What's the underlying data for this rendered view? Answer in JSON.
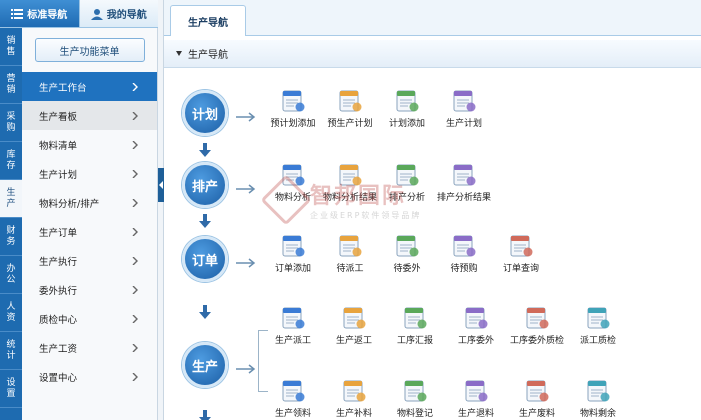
{
  "left_tabs": [
    {
      "label": "标准导航",
      "icon": "list-icon",
      "active": true
    },
    {
      "label": "我的导航",
      "icon": "user-icon",
      "active": false
    }
  ],
  "categories": [
    {
      "label": "销售",
      "active": false
    },
    {
      "label": "营销",
      "active": false
    },
    {
      "label": "采购",
      "active": false
    },
    {
      "label": "库存",
      "active": false
    },
    {
      "label": "生产",
      "active": true
    },
    {
      "label": "财务",
      "active": false
    },
    {
      "label": "办公",
      "active": false
    },
    {
      "label": "人资",
      "active": false
    },
    {
      "label": "统计",
      "active": false
    },
    {
      "label": "设置",
      "active": false
    }
  ],
  "menu": {
    "header_button": "生产功能菜单",
    "items": [
      {
        "label": "生产工作台",
        "state": "active"
      },
      {
        "label": "生产看板",
        "state": "hover"
      },
      {
        "label": "物料清单",
        "state": ""
      },
      {
        "label": "生产计划",
        "state": ""
      },
      {
        "label": "物料分析/排产",
        "state": ""
      },
      {
        "label": "生产订单",
        "state": ""
      },
      {
        "label": "生产执行",
        "state": ""
      },
      {
        "label": "委外执行",
        "state": ""
      },
      {
        "label": "质检中心",
        "state": ""
      },
      {
        "label": "生产工资",
        "state": ""
      },
      {
        "label": "设置中心",
        "state": ""
      }
    ]
  },
  "main_tab": "生产导航",
  "panel_title": "生产导航",
  "flow": {
    "stages": [
      "计划",
      "排产",
      "订单",
      "生产"
    ],
    "plan_items": [
      {
        "label": "预计划添加",
        "icon": "form-user-icon"
      },
      {
        "label": "预生产计划",
        "icon": "search-window-icon"
      },
      {
        "label": "计划添加",
        "icon": "grid-add-icon"
      },
      {
        "label": "生产计划",
        "icon": "magnifier-doc-icon"
      }
    ],
    "schedule_items": [
      {
        "label": "物料分析",
        "icon": "bar-chart-icon"
      },
      {
        "label": "物料分析结果",
        "icon": "table-chart-icon"
      },
      {
        "label": "排产分析",
        "icon": "calendar-check-icon"
      },
      {
        "label": "排产分析结果",
        "icon": "pie-table-icon"
      }
    ],
    "order_items": [
      {
        "label": "订单添加",
        "icon": "doc-edit-icon"
      },
      {
        "label": "待派工",
        "icon": "window-list-icon"
      },
      {
        "label": "待委外",
        "icon": "clipboard-icon"
      },
      {
        "label": "待预购",
        "icon": "excel-sheet-icon"
      },
      {
        "label": "订单查询",
        "icon": "globe-search-icon"
      }
    ],
    "production_items_row1": [
      {
        "label": "生产派工",
        "icon": "dispatch-window-icon"
      },
      {
        "label": "生产返工",
        "icon": "folder-arrow-icon"
      },
      {
        "label": "工序汇报",
        "icon": "doc-pencil-icon"
      },
      {
        "label": "工序委外",
        "icon": "clipboard-list-icon"
      },
      {
        "label": "工序委外质检",
        "icon": "doc-person-icon"
      },
      {
        "label": "派工质检",
        "icon": "shield-doc-icon"
      }
    ],
    "production_items_row2": [
      {
        "label": "生产领料",
        "icon": "pencil-box-icon"
      },
      {
        "label": "生产补料",
        "icon": "swap-box-icon"
      },
      {
        "label": "物料登记",
        "icon": "check-doc-icon"
      },
      {
        "label": "生产退料",
        "icon": "return-doc-icon"
      },
      {
        "label": "生产废料",
        "icon": "gauge-icon"
      },
      {
        "label": "物料剩余",
        "icon": "warehouse-icon"
      }
    ]
  },
  "watermark": {
    "main": "智邦国际",
    "sub": "企业级ERP软件领导品牌"
  },
  "colors": {
    "primary": "#1f72bf",
    "nav_dark": "#1e6bb0",
    "stage_circle": "#2a73bf"
  }
}
